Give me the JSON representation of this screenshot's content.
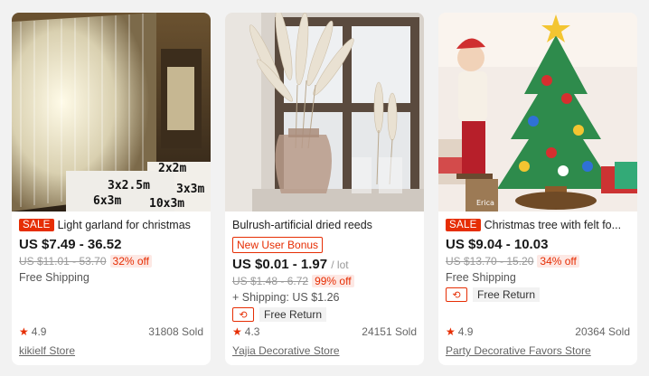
{
  "products": [
    {
      "image_alt": "",
      "image_overlay_lines": [
        "2x2m",
        "3x2.5m",
        "3x3m",
        "6x3m",
        "10x3m"
      ],
      "sale_badge": "SALE",
      "title": "Light garland for christmas",
      "price": "US $7.49 - 36.52",
      "old_price": "US $11.01 - 53.70",
      "discount": "32% off",
      "shipping": "Free Shipping",
      "rating": "4.9",
      "sold": "31808 Sold",
      "store": "kikielf Store"
    },
    {
      "image_alt": "",
      "title": "Bulrush-artificial dried reeds",
      "promo": "New User Bonus",
      "price": "US $0.01 - 1.97",
      "price_unit": "/ lot",
      "old_price": "US $1.48 - 6.72",
      "discount": "99% off",
      "shipping": "+ Shipping: US $1.26",
      "return_label": "Free Return",
      "rating": "4.3",
      "sold": "24151 Sold",
      "store": "Yajia Decorative Store"
    },
    {
      "image_alt": "",
      "image_overlay_label": "Erica",
      "sale_badge": "SALE",
      "title": "Christmas tree with felt fo...",
      "price": "US $9.04 - 10.03",
      "old_price": "US $13.70 - 15.20",
      "discount": "34% off",
      "shipping": "Free Shipping",
      "return_label": "Free Return",
      "rating": "4.9",
      "sold": "20364 Sold",
      "store": "Party Decorative Favors Store"
    }
  ],
  "icons": {
    "star": "star-icon",
    "return": "free-return-icon"
  },
  "colors": {
    "accent": "#e62e04",
    "muted": "#999999",
    "card_bg": "#ffffff",
    "page_bg": "#f2f2f2"
  }
}
